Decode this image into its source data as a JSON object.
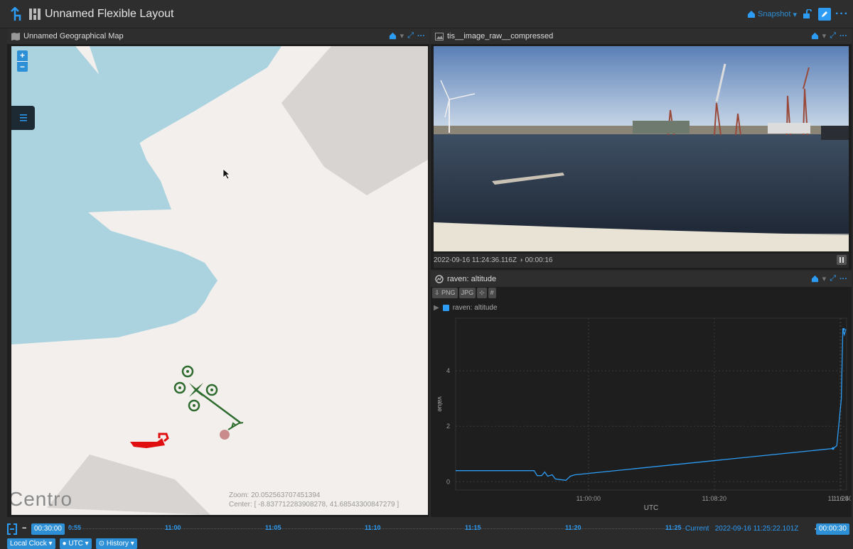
{
  "app": {
    "title": "Unnamed Flexible Layout",
    "snapshot_label": "Snapshot"
  },
  "map_panel": {
    "title": "Unnamed Geographical Map",
    "zoom_in": "+",
    "zoom_out": "−",
    "zoom_text": "Zoom: 20.052563707451394",
    "center_text": "Center: [ -8.837712283908278, 41.68543300847279 ]",
    "place_label": "Centro"
  },
  "image_panel": {
    "title": "tis__image_raw__compressed",
    "timestamp": "2022-09-16 11:24:36.116Z",
    "elapsed": "00:00:16"
  },
  "plot_panel": {
    "title": "raven: altitude",
    "tools": [
      "PNG",
      "JPG",
      "⊹",
      "#"
    ],
    "legend_label": "raven: altitude"
  },
  "chart_data": {
    "type": "line",
    "xlabel": "UTC",
    "ylabel": "value",
    "x_ticks": [
      "11:00:00",
      "11:08:20",
      "11:16:40",
      "11:25"
    ],
    "y_ticks": [
      "0",
      "2",
      "4"
    ],
    "ylim": [
      -0.3,
      5.9
    ],
    "series": [
      {
        "name": "raven: altitude",
        "color": "#2d9cf5",
        "x_minutes": [
          -0.5,
          -0.2,
          0,
          0.2,
          0.4,
          0.8,
          1.0,
          1.4,
          2.0,
          2.4,
          2.6,
          2.9,
          3.2,
          3.6,
          3.9,
          4.2,
          4.5,
          5.0,
          5.3,
          23.2,
          23.45,
          23.9,
          24.2,
          24.6,
          24.8
        ],
        "x_minutes_offset_from": "10:52:00",
        "values": [
          0.4,
          0.4,
          0.4,
          0.4,
          0.4,
          0.4,
          0.4,
          0.4,
          0.4,
          0.4,
          0.4,
          0.4,
          0.4,
          0.4,
          0.4,
          0.4,
          0.4,
          0.4,
          0.4,
          1.2,
          1.3,
          3.0,
          5.5,
          5.4,
          5.2
        ]
      }
    ]
  },
  "timeline": {
    "duration": "00:30:00",
    "start_tick": "0:55",
    "ticks": [
      "11:00",
      "11:05",
      "11:10",
      "11:15",
      "11:20",
      "11:25"
    ],
    "current_label": "Current",
    "current_time": "2022-09-16 11:25:22.101Z",
    "plus": "+",
    "step": "00:00:30",
    "buttons": [
      "Local Clock",
      "UTC",
      "History"
    ]
  }
}
